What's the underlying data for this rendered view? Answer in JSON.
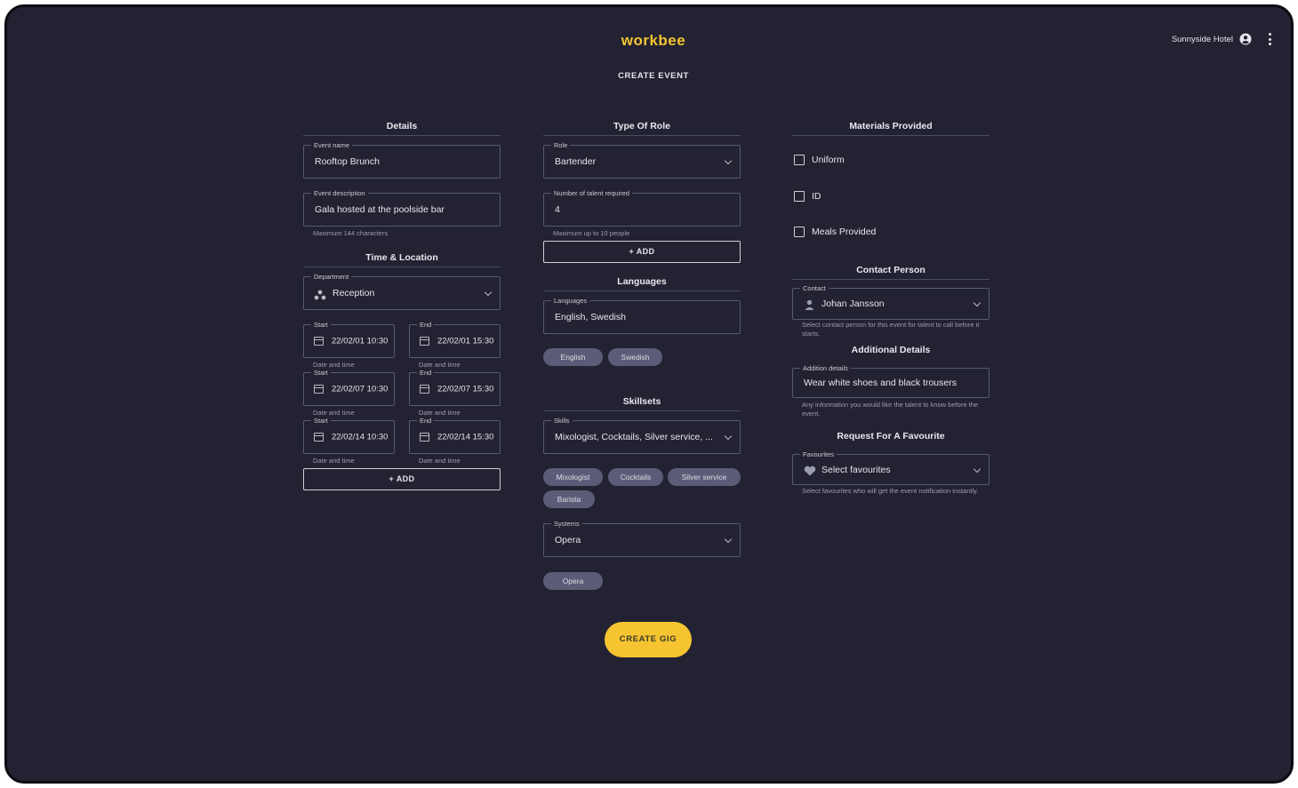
{
  "header": {
    "logo": "workbee",
    "page_title": "CREATE EVENT",
    "user_name": "Sunnyside Hotel"
  },
  "details": {
    "title": "Details",
    "event_name_label": "Event name",
    "event_name_value": "Rooftop Brunch",
    "event_desc_label": "Event description",
    "event_desc_value": "Gala hosted at the poolside bar",
    "event_desc_helper": "Maximum 144 characters"
  },
  "time_location": {
    "title": "Time & Location",
    "department_label": "Department",
    "department_value": "Reception",
    "slots": [
      {
        "start_label": "Start",
        "start_value": "22/02/01 10:30",
        "start_helper": "Date and time",
        "end_label": "End",
        "end_value": "22/02/01 15:30",
        "end_helper": "Date and time"
      },
      {
        "start_label": "Start",
        "start_value": "22/02/07 10:30",
        "start_helper": "Date and time",
        "end_label": "End",
        "end_value": "22/02/07 15:30",
        "end_helper": "Date and time"
      },
      {
        "start_label": "Start",
        "start_value": "22/02/14 10:30",
        "start_helper": "Date and time",
        "end_label": "End",
        "end_value": "22/02/14 15:30",
        "end_helper": "Date and time"
      }
    ],
    "add_label": "+ ADD"
  },
  "role": {
    "title": "Type Of Role",
    "role_label": "Role",
    "role_value": "Bartender",
    "talent_label": "Number of talent required",
    "talent_value": "4",
    "talent_helper": "Maximum up to 10 people",
    "add_label": "+ ADD"
  },
  "languages": {
    "title": "Languages",
    "label": "Languages",
    "value": "English, Swedish",
    "chips": [
      "English",
      "Swedish"
    ]
  },
  "skillsets": {
    "title": "Skillsets",
    "label": "Skills",
    "value": "Mixologist, Cocktails, Silver service, ...",
    "chips": [
      "Mixologist",
      "Cocktails",
      "Silver service",
      "Barista"
    ],
    "systems_label": "Systems",
    "systems_value": "Opera",
    "systems_chips": [
      "Opera"
    ]
  },
  "materials": {
    "title": "Materials Provided",
    "items": [
      "Uniform",
      "ID",
      "Meals Provided"
    ]
  },
  "contact": {
    "title": "Contact Person",
    "label": "Contact",
    "value": "Johan Jansson",
    "helper": "Select contact person for this event for talent to call before it starts."
  },
  "additional": {
    "title": "Additional Details",
    "label": "Addition details",
    "value": "Wear white shoes and black trousers",
    "helper": "Any information you would like the talent to know before the event."
  },
  "favourite": {
    "title": "Request For A Favourite",
    "label": "Favourites",
    "value": "Select favourites",
    "helper": "Select favourites who will get the event notification instantly."
  },
  "actions": {
    "create_label": "CREATE GIG"
  },
  "colors": {
    "background": "#222232",
    "accent": "#f5c430",
    "chip": "#5c5c78"
  }
}
